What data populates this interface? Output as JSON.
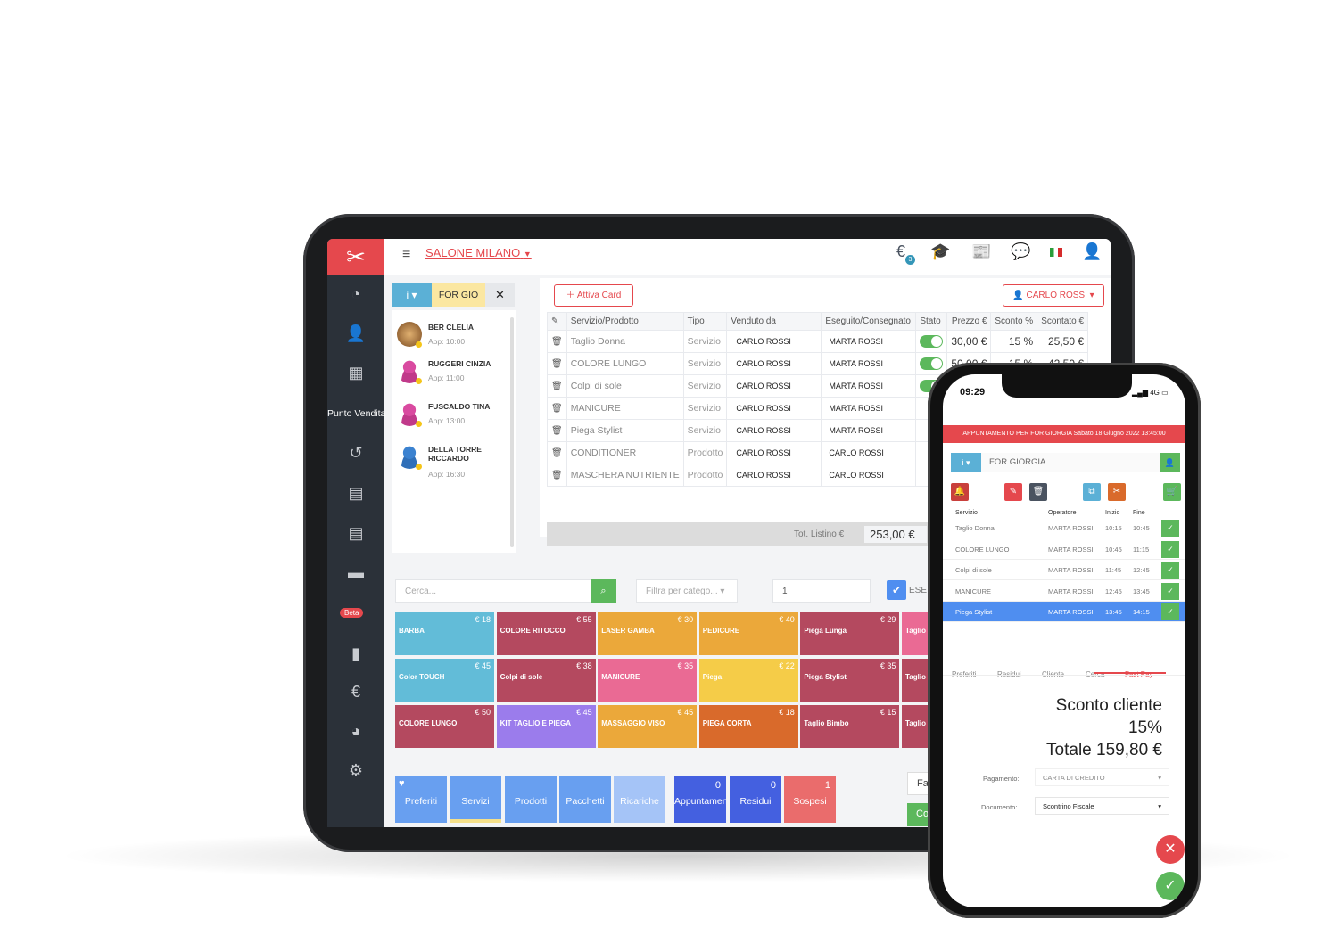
{
  "tablet": {
    "salon": "SALONE MILANO",
    "sidebar_label": "Punto Vendita",
    "beta": "Beta",
    "euro_badge": "3",
    "client_button": "FOR GIO",
    "info_button": "i",
    "clients": [
      {
        "name": "BER CLELIA",
        "app": "App: 10:00",
        "avatar": "photo"
      },
      {
        "name": "RUGGERI CINZIA",
        "app": "App: 11:00",
        "avatar": "female"
      },
      {
        "name": "FUSCALDO TINA",
        "app": "App: 13:00",
        "avatar": "female"
      },
      {
        "name": "DELLA TORRE RICCARDO",
        "app": "App: 16:30",
        "avatar": "male"
      }
    ],
    "activate_card": "Attiva Card",
    "operator": "CARLO ROSSI",
    "columns": [
      "Servizio/Prodotto",
      "Tipo",
      "Venduto da",
      "Eseguito/Consegnato",
      "Stato",
      "Prezzo €",
      "Sconto %",
      "Scontato €"
    ],
    "rows": [
      {
        "item": "Taglio Donna",
        "type": "Servizio",
        "sold_by": "CARLO ROSSI",
        "done_by": "MARTA ROSSI",
        "status": true,
        "price": "30,00 €",
        "discount": "15 %",
        "discounted": "25,50 €"
      },
      {
        "item": "COLORE LUNGO",
        "type": "Servizio",
        "sold_by": "CARLO ROSSI",
        "done_by": "MARTA ROSSI",
        "status": true,
        "price": "50,00 €",
        "discount": "15 %",
        "discounted": "42,50 €"
      },
      {
        "item": "Colpi di sole",
        "type": "Servizio",
        "sold_by": "CARLO ROSSI",
        "done_by": "MARTA ROSSI",
        "status": true
      },
      {
        "item": "MANICURE",
        "type": "Servizio",
        "sold_by": "CARLO ROSSI",
        "done_by": "MARTA ROSSI"
      },
      {
        "item": "Piega Stylist",
        "type": "Servizio",
        "sold_by": "CARLO ROSSI",
        "done_by": "MARTA ROSSI"
      },
      {
        "item": "CONDITIONER",
        "type": "Prodotto",
        "sold_by": "CARLO ROSSI",
        "done_by": "CARLO ROSSI"
      },
      {
        "item": "MASCHERA NUTRIENTE",
        "type": "Prodotto",
        "sold_by": "CARLO ROSSI",
        "done_by": "CARLO ROSSI"
      }
    ],
    "total_label": "Tot. Listino €",
    "total_value": "253,00 €",
    "search_placeholder": "Cerca...",
    "filter_placeholder": "Filtra per catego...",
    "quantity": "1",
    "exec_label": "ESE",
    "tiles": [
      {
        "name": "BARBA",
        "price": "€ 18",
        "color": "#62bcd8"
      },
      {
        "name": "COLORE RITOCCO",
        "price": "€ 55",
        "color": "#b4495f"
      },
      {
        "name": "LASER GAMBA",
        "price": "€ 30",
        "color": "#eba83a"
      },
      {
        "name": "PEDICURE",
        "price": "€ 40",
        "color": "#eba83a"
      },
      {
        "name": "Piega Lunga",
        "price": "€ 29",
        "color": "#b4495f"
      },
      {
        "name": "Taglio",
        "price": "",
        "color": "#ea6a94"
      },
      {
        "name": "Color TOUCH",
        "price": "€ 45",
        "color": "#62bcd8"
      },
      {
        "name": "Colpi di sole",
        "price": "€ 38",
        "color": "#b4495f"
      },
      {
        "name": "MANICURE",
        "price": "€ 35",
        "color": "#ea6a94"
      },
      {
        "name": "Piega",
        "price": "€ 22",
        "color": "#f5cc48"
      },
      {
        "name": "Piega Stylist",
        "price": "€ 35",
        "color": "#b4495f"
      },
      {
        "name": "Taglio",
        "price": "",
        "color": "#b4495f"
      },
      {
        "name": "COLORE LUNGO",
        "price": "€ 50",
        "color": "#b4495f"
      },
      {
        "name": "KIT TAGLIO E PIEGA",
        "price": "€ 45",
        "color": "#9b7cec"
      },
      {
        "name": "MASSAGGIO VISO",
        "price": "€ 45",
        "color": "#eba83a"
      },
      {
        "name": "PIEGA CORTA",
        "price": "€ 18",
        "color": "#d96a2b"
      },
      {
        "name": "Taglio Bimbo",
        "price": "€ 15",
        "color": "#b4495f"
      },
      {
        "name": "Taglio",
        "price": "",
        "color": "#b4495f"
      }
    ],
    "bottom_tabs": [
      {
        "label": "Preferiti",
        "count": "",
        "color": "#689ff0",
        "icon": "heart-icon"
      },
      {
        "label": "Servizi",
        "count": "",
        "color": "#689ff0",
        "active": true
      },
      {
        "label": "Prodotti",
        "count": "",
        "color": "#689ff0"
      },
      {
        "label": "Pacchetti",
        "count": "",
        "color": "#689ff0"
      },
      {
        "label": "Ricariche",
        "count": "",
        "color": "#a5c4f7"
      },
      {
        "label": "Appuntamenti",
        "count": "0",
        "color": "#4460e0"
      },
      {
        "label": "Residui",
        "count": "0",
        "color": "#4460e0"
      },
      {
        "label": "Sospesi",
        "count": "1",
        "color": "#ea6c6c"
      }
    ],
    "side_buttons": [
      "Fa",
      "Co"
    ]
  },
  "phone": {
    "time": "09:29",
    "network": "4G",
    "banner": "APPUNTAMENTO PER FOR GIORGIA Sabato 18 Giugno 2022 13:45:00",
    "client": "FOR GIORGIA",
    "info_button": "i",
    "columns": [
      "Servizio",
      "Operatore",
      "Inizio",
      "Fine"
    ],
    "rows": [
      {
        "service": "Taglio Donna",
        "operator": "MARTA ROSSI",
        "start": "10:15",
        "end": "10:45"
      },
      {
        "service": "COLORE LUNGO",
        "operator": "MARTA ROSSI",
        "start": "10:45",
        "end": "11:15"
      },
      {
        "service": "Colpi di sole",
        "operator": "MARTA ROSSI",
        "start": "11:45",
        "end": "12:45"
      },
      {
        "service": "MANICURE",
        "operator": "MARTA ROSSI",
        "start": "12:45",
        "end": "13:45"
      },
      {
        "service": "Piega Stylist",
        "operator": "MARTA ROSSI",
        "start": "13:45",
        "end": "14:15",
        "selected": true
      }
    ],
    "tabs": [
      "Preferiti",
      "Residui",
      "Cliente",
      "Cerca",
      "Fast Pay"
    ],
    "active_tab": "Fast Pay",
    "discount_title": "Sconto cliente",
    "discount_value": "15%",
    "total": "Totale 159,80 €",
    "payment_label": "Pagamento:",
    "payment_value": "CARTA DI CREDITO",
    "document_label": "Documento:",
    "document_value": "Scontrino Fiscale"
  },
  "colors": {
    "accent": "#e5484d",
    "sidebar": "#2b3139",
    "success": "#5cb85c",
    "info": "#5bb0d6",
    "selected": "#4f8ef0"
  }
}
